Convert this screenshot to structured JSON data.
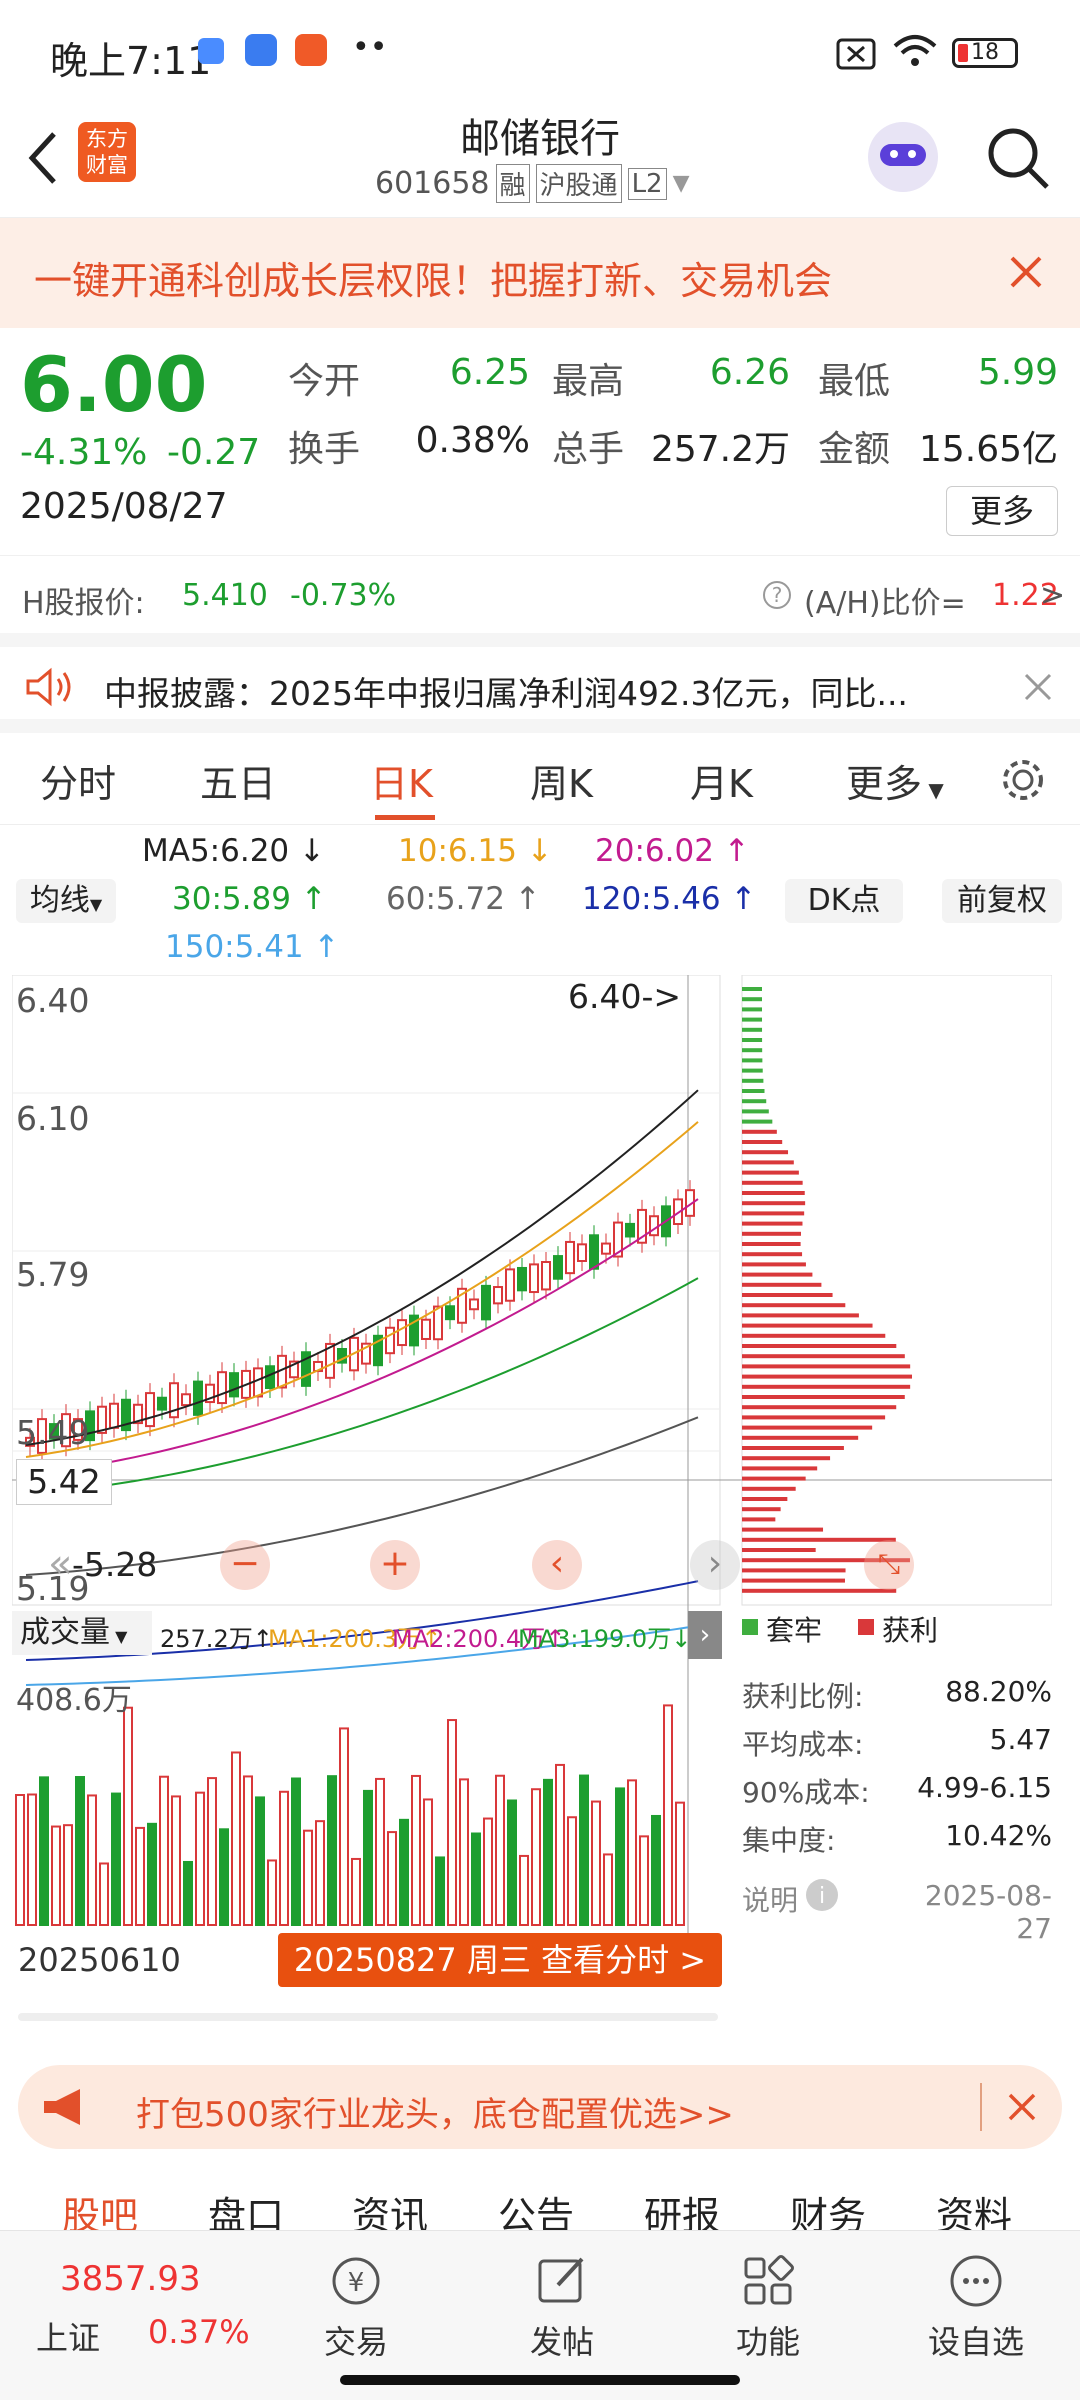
{
  "status": {
    "time": "晚上7:11",
    "battery": "18"
  },
  "nav": {
    "logo_line1": "东方",
    "logo_line2": "财富",
    "title": "邮储银行",
    "code": "601658",
    "tags": [
      "融",
      "沪股通",
      "L2"
    ]
  },
  "promo": {
    "text": "一键开通科创成长层权限！把握打新、交易机会"
  },
  "quote": {
    "price": "6.00",
    "change_pct": "-4.31%",
    "change": "-0.27",
    "date": "2025/08/27",
    "fields": [
      {
        "label": "今开",
        "value": "6.25",
        "color": "green"
      },
      {
        "label": "最高",
        "value": "6.26",
        "color": "green"
      },
      {
        "label": "最低",
        "value": "5.99",
        "color": "green"
      },
      {
        "label": "换手",
        "value": "0.38%",
        "color": "black"
      },
      {
        "label": "总手",
        "value": "257.2万",
        "color": "black"
      },
      {
        "label": "金额",
        "value": "15.65亿",
        "color": "black"
      }
    ],
    "more": "更多"
  },
  "hshare": {
    "label": "H股报价:",
    "price": "5.410",
    "pct": "-0.73%",
    "ratio_label": "(A/H)比价=",
    "ratio": "1.22",
    "arrow": ">"
  },
  "notice": {
    "text": "中报披露：2025年中报归属净利润492.3亿元，同比..."
  },
  "tabs": [
    "分时",
    "五日",
    "日K",
    "周K",
    "月K",
    "更多"
  ],
  "active_tab": 2,
  "ma": {
    "ma5": "MA5:6.20",
    "ma10": "10:6.15",
    "ma20": "20:6.02",
    "ma30": "30:5.89",
    "ma60": "60:5.72",
    "ma120": "120:5.46",
    "ma150": "150:5.41",
    "mode": "均线",
    "dk": "DK点",
    "fq": "前复权"
  },
  "chart": {
    "ytop": "6.40",
    "y2": "6.10",
    "y3": "5.79",
    "y4": "5.49",
    "y5": "5.19",
    "price_tag": "5.42",
    "high_mark": "6.40->",
    "low_mark": "-5.28",
    "vol_label": "成交量",
    "vol_val": "257.2万",
    "vma1": "MA1:200.3万",
    "vma2": "MA2:200.4万",
    "vma3": "MA3:199.0万",
    "vol_max": "408.6万",
    "start_date": "20250610",
    "end_btn": "20250827 周三 查看分时 >"
  },
  "chip": {
    "legend_trapped": "套牢",
    "legend_profit": "获利",
    "rows": [
      {
        "k": "获利比例:",
        "v": "88.20%"
      },
      {
        "k": "平均成本:",
        "v": "5.47"
      },
      {
        "k": "90%成本:",
        "v": "4.99-6.15"
      },
      {
        "k": "集中度:",
        "v": "10.42%"
      }
    ],
    "note": "说明",
    "date": "2025-08-27"
  },
  "banner": {
    "text": "打包500家行业龙头，底仓配置优选>>"
  },
  "subtabs": [
    "股吧",
    "盘口",
    "资讯",
    "公告",
    "研报",
    "财务",
    "资料"
  ],
  "bottom": {
    "index_val": "3857.93",
    "index_name": "上证",
    "index_pct": "0.37%",
    "items": [
      "交易",
      "发帖",
      "功能",
      "设自选"
    ]
  },
  "colors": {
    "up": "#e33333",
    "down": "#1d9e2f",
    "accent": "#e2502b"
  }
}
